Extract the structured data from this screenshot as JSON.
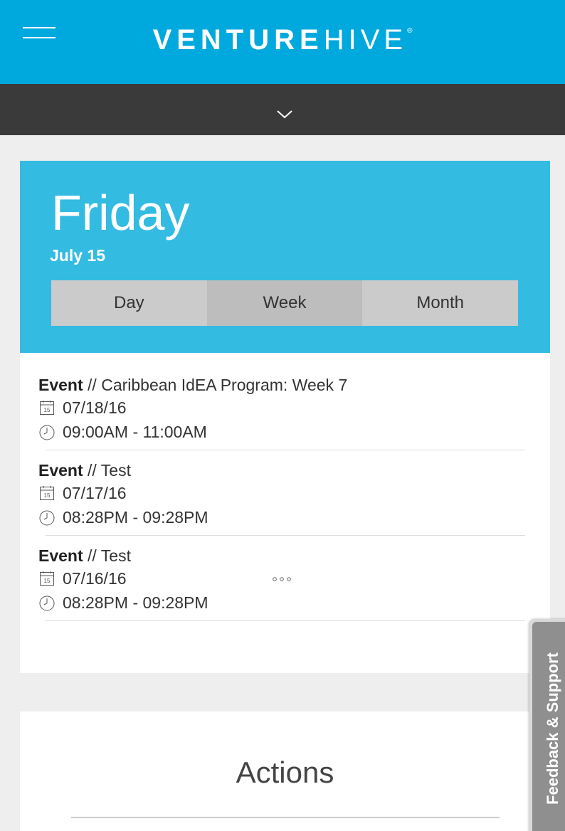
{
  "header": {
    "logo_bold": "VENTURE",
    "logo_thin": "HIVE",
    "logo_mark": "®"
  },
  "icons": {
    "menu": "hamburger-menu-icon",
    "toggle": "chevron-down-icon",
    "date": "calendar-icon",
    "time": "clock-icon",
    "loading": "loading-dots-icon"
  },
  "colors": {
    "brand": "#00a9dd",
    "calendar_header": "#33bbe2",
    "subbar": "#3a3a3a",
    "feedback_tab": "#8f8f8f"
  },
  "calendar": {
    "day": "Friday",
    "date": "July 15",
    "views": [
      "Day",
      "Week",
      "Month"
    ],
    "active_view": "Week"
  },
  "events": [
    {
      "type": "Event",
      "sep": " // ",
      "title": "Caribbean IdEA Program: Week 7",
      "date": "07/18/16",
      "time": "09:00AM - 11:00AM",
      "cal_day": "15"
    },
    {
      "type": "Event",
      "sep": " // ",
      "title": "Test",
      "date": "07/17/16",
      "time": "08:28PM - 09:28PM",
      "cal_day": "15"
    },
    {
      "type": "Event",
      "sep": " // ",
      "title": "Test",
      "date": "07/16/16",
      "time": "08:28PM - 09:28PM",
      "cal_day": "15"
    }
  ],
  "actions": {
    "title": "Actions"
  },
  "feedback": {
    "label": "Feedback & Support"
  }
}
